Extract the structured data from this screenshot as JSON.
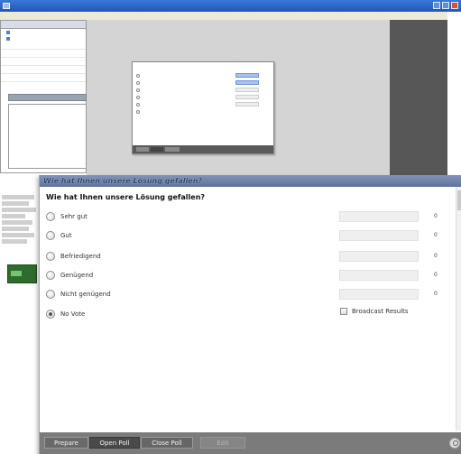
{
  "background_app": {
    "title": "",
    "menu": [
      "",
      "",
      "",
      "",
      "",
      ""
    ],
    "tree_items": [
      {
        "label": ""
      },
      {
        "label": ""
      }
    ]
  },
  "dialog": {
    "title": "Wie hat Ihnen unsere Lösung gefallen?",
    "question": "Wie hat Ihnen unsere Lösung gefallen?",
    "options": [
      {
        "label": "Sehr gut",
        "count": "0",
        "checked": false
      },
      {
        "label": "Gut",
        "count": "0",
        "checked": false
      },
      {
        "label": "Befriedigend",
        "count": "0",
        "checked": false
      },
      {
        "label": "Genügend",
        "count": "0",
        "checked": false
      },
      {
        "label": "Nicht genügend",
        "count": "0",
        "checked": false
      },
      {
        "label": "No Vote",
        "count": "",
        "checked": true
      }
    ],
    "broadcast_label": "Broadcast Results",
    "buttons": {
      "prepare": "Prepare",
      "open": "Open Poll",
      "close": "Close Poll",
      "extra": "Edit"
    }
  },
  "colors": {
    "dialog_titlebar": "#6a7da5",
    "footer": "#7b7b7b",
    "canvas": "#d4d4d4",
    "dark_panel": "#575757"
  },
  "icons": [
    "window-icon",
    "radio-icon",
    "checkbox-icon",
    "search-icon"
  ]
}
